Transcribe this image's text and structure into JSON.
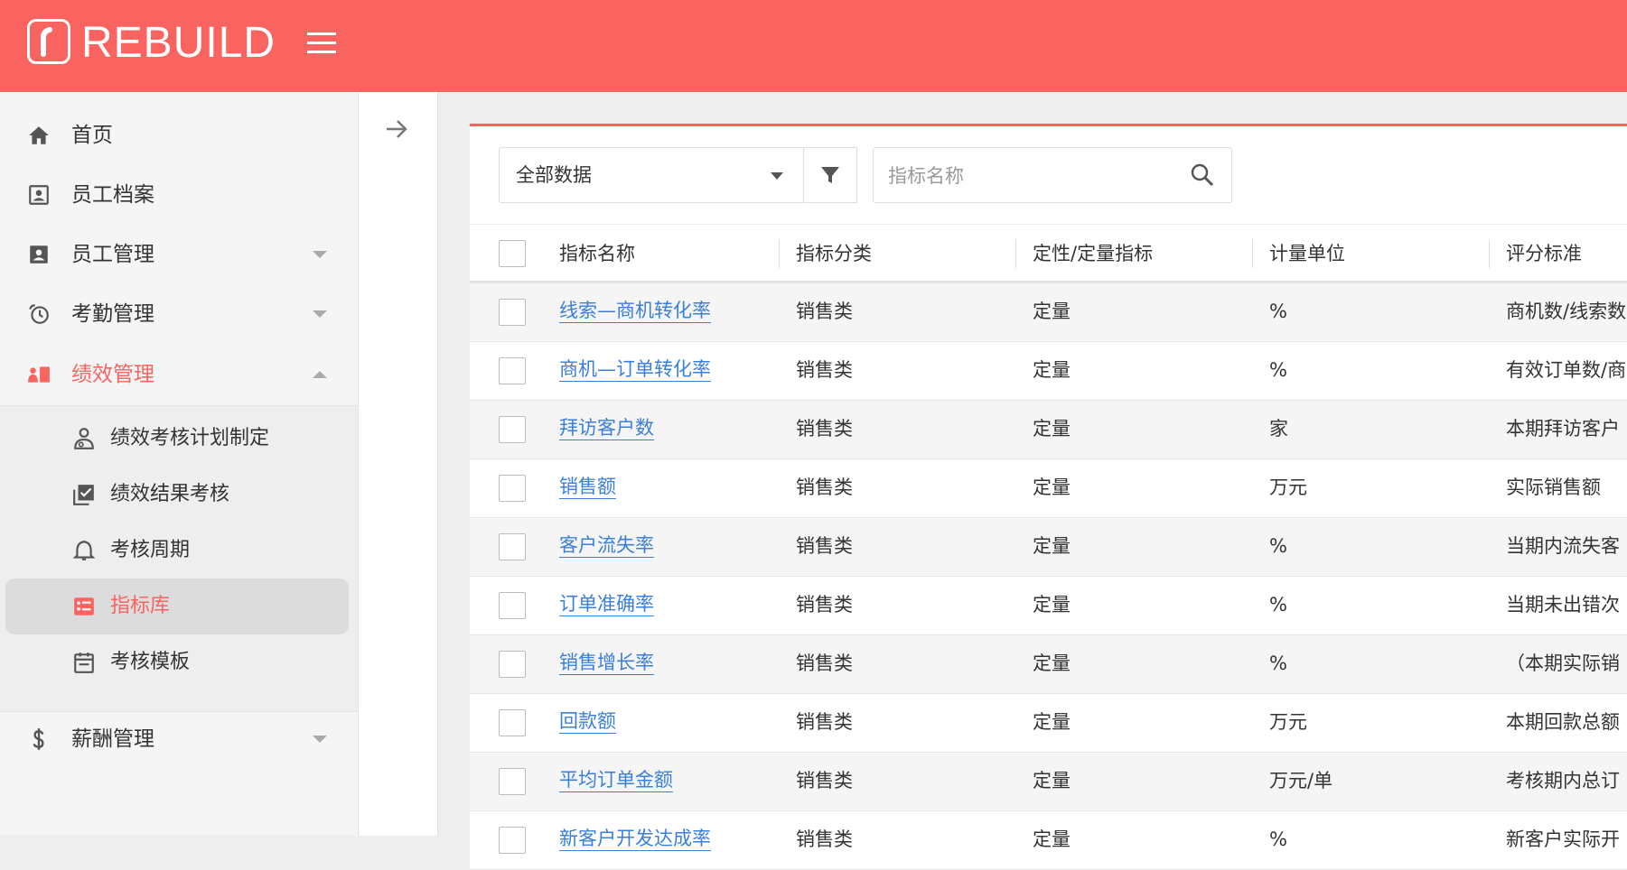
{
  "header": {
    "logo_text": "REBUILD"
  },
  "sidebar": {
    "items": [
      {
        "label": "首页"
      },
      {
        "label": "员工档案"
      },
      {
        "label": "员工管理"
      },
      {
        "label": "考勤管理"
      },
      {
        "label": "绩效管理"
      },
      {
        "label": "薪酬管理"
      }
    ],
    "submenu": [
      {
        "label": "绩效考核计划制定"
      },
      {
        "label": "绩效结果考核"
      },
      {
        "label": "考核周期"
      },
      {
        "label": "指标库"
      },
      {
        "label": "考核模板"
      }
    ]
  },
  "toolbar": {
    "filter_value": "全部数据",
    "search_placeholder": "指标名称"
  },
  "table": {
    "headers": [
      "指标名称",
      "指标分类",
      "定性/定量指标",
      "计量单位",
      "评分标准"
    ],
    "rows": [
      [
        "线索—商机转化率",
        "销售类",
        "定量",
        "%",
        "商机数/线索数"
      ],
      [
        "商机—订单转化率",
        "销售类",
        "定量",
        "%",
        "有效订单数/商"
      ],
      [
        "拜访客户数",
        "销售类",
        "定量",
        "家",
        "本期拜访客户"
      ],
      [
        "销售额",
        "销售类",
        "定量",
        "万元",
        "实际销售额"
      ],
      [
        "客户流失率",
        "销售类",
        "定量",
        "%",
        "当期内流失客"
      ],
      [
        "订单准确率",
        "销售类",
        "定量",
        "%",
        "当期未出错次"
      ],
      [
        "销售增长率",
        "销售类",
        "定量",
        "%",
        "（本期实际销"
      ],
      [
        "回款额",
        "销售类",
        "定量",
        "万元",
        "本期回款总额"
      ],
      [
        "平均订单金额",
        "销售类",
        "定量",
        "万元/单",
        "考核期内总订"
      ],
      [
        "新客户开发达成率",
        "销售类",
        "定量",
        "%",
        "新客户实际开"
      ]
    ]
  },
  "colors": {
    "brand": "#f96360",
    "link": "#3a7fd9"
  }
}
